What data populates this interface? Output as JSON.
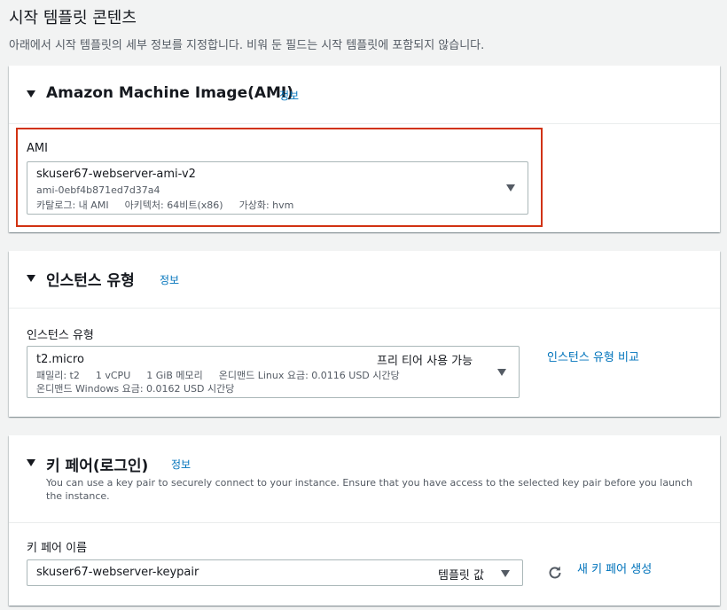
{
  "page": {
    "title": "시작 템플릿 콘텐츠",
    "description": "아래에서 시작 템플릿의 세부 정보를 지정합니다. 비워 둔 필드는 시작 템플릿에 포함되지 않습니다."
  },
  "ami": {
    "section_title": "Amazon Machine Image(AMI)",
    "info": "정보",
    "label": "AMI",
    "selected_name": "skuser67-webserver-ami-v2",
    "selected_id": "ami-0ebf4b871ed7d37a4",
    "catalog": "카탈로그: 내 AMI",
    "architecture": "아키텍처: 64비트(x86)",
    "virtualization": "가상화: hvm",
    "highlight_color": "#d13212"
  },
  "instance_type": {
    "section_title": "인스턴스 유형",
    "info": "정보",
    "label": "인스턴스 유형",
    "selected": "t2.micro",
    "free_tier": "프리 티어 사용 가능",
    "family": "패밀리: t2",
    "vcpu": "1 vCPU",
    "memory": "1 GiB 메모리",
    "linux_price": "온디맨드 Linux 요금: 0.0116 USD 시간당",
    "windows_price": "온디맨드 Windows 요금: 0.0162 USD 시간당",
    "compare_link": "인스턴스 유형 비교"
  },
  "key_pair": {
    "section_title": "키 페어(로그인)",
    "info": "정보",
    "description": "You can use a key pair to securely connect to your instance. Ensure that you have access to the selected key pair before you launch the instance.",
    "label": "키 페어 이름",
    "selected": "skuser67-webserver-keypair",
    "template_value": "템플릿 값",
    "refresh_icon": "refresh-icon",
    "create_link": "새 키 페어 생성"
  },
  "colors": {
    "link": "#0073bb",
    "background": "#f2f3f3"
  }
}
